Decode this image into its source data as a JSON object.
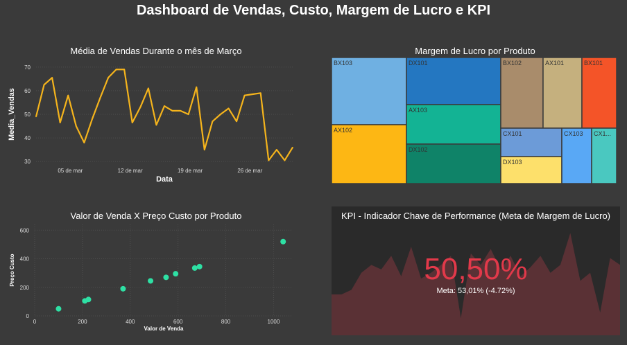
{
  "page": {
    "title": "Dashboard de Vendas, Custo, Margem de Lucro e KPI"
  },
  "line_chart": {
    "title": "Média de Vendas Durante o mês de Março",
    "xlabel": "Data",
    "ylabel": "Media_Vendas",
    "color": "#f5b41c"
  },
  "treemap": {
    "title": "Margem de Lucro por Produto"
  },
  "scatter": {
    "title": "Valor de Venda X Preço Custo por Produto",
    "xlabel": "Valor de Venda",
    "ylabel": "Preço Custo",
    "color": "#2ee0a4"
  },
  "kpi": {
    "title": "KPI - Indicador Chave de Performance (Meta de Margem de Lucro)",
    "value": "50,50%",
    "target": "Meta: 53,01% (-4.72%)",
    "value_color": "#e2394a",
    "area_color": "#5a3135"
  },
  "chart_data": [
    {
      "type": "line",
      "title": "Média de Vendas Durante o mês de Março",
      "xlabel": "Data",
      "ylabel": "Media_Vendas",
      "x_ticks": [
        "05 de mar",
        "12 de mar",
        "19 de mar",
        "26 de mar"
      ],
      "x_tick_days": [
        5,
        12,
        19,
        26
      ],
      "y_ticks": [
        30,
        40,
        50,
        60,
        70
      ],
      "ylim": [
        28,
        72
      ],
      "xlim": [
        1,
        31
      ],
      "x": [
        1,
        2,
        3,
        4,
        5,
        6,
        7,
        8,
        9,
        10,
        11,
        12,
        13,
        14,
        15,
        16,
        17,
        18,
        19,
        20,
        21,
        22,
        23,
        24,
        25,
        26,
        27,
        28,
        29,
        30,
        31
      ],
      "values": [
        49,
        62.5,
        65.5,
        46.5,
        58,
        45,
        38,
        48,
        57,
        65.5,
        69,
        69,
        46.5,
        53,
        61,
        45.5,
        53.5,
        51.5,
        51.5,
        50,
        61.5,
        35,
        47,
        50,
        52.5,
        47,
        58,
        58.5,
        59,
        30.5,
        35,
        30.5,
        36
      ],
      "grid": true
    },
    {
      "type": "treemap",
      "title": "Margem de Lucro por Produto",
      "items": [
        {
          "name": "BX103",
          "color": "#6fb0e2"
        },
        {
          "name": "AX102",
          "color": "#fdb714"
        },
        {
          "name": "DX101",
          "color": "#2477c1"
        },
        {
          "name": "AX103",
          "color": "#13b394"
        },
        {
          "name": "DX102",
          "color": "#0f8368"
        },
        {
          "name": "BX102",
          "color": "#a98c6b"
        },
        {
          "name": "AX101",
          "color": "#c5b07e"
        },
        {
          "name": "BX101",
          "color": "#f45428"
        },
        {
          "name": "CX101",
          "color": "#6c9bd8"
        },
        {
          "name": "DX103",
          "color": "#fde06b"
        },
        {
          "name": "CX103",
          "color": "#59a8f5"
        },
        {
          "name": "CX1...",
          "color": "#4ac8c0"
        }
      ]
    },
    {
      "type": "scatter",
      "title": "Valor de Venda X Preço Custo por Produto",
      "xlabel": "Valor de Venda",
      "ylabel": "Preço Custo",
      "x_ticks": [
        0,
        200,
        400,
        600,
        800,
        1000
      ],
      "y_ticks": [
        0,
        200,
        400,
        600
      ],
      "xlim": [
        0,
        1080
      ],
      "ylim": [
        0,
        640
      ],
      "points": [
        [
          100,
          50
        ],
        [
          210,
          105
        ],
        [
          225,
          115
        ],
        [
          370,
          190
        ],
        [
          485,
          245
        ],
        [
          550,
          270
        ],
        [
          590,
          295
        ],
        [
          670,
          335
        ],
        [
          690,
          345
        ],
        [
          1040,
          520
        ]
      ],
      "grid": true
    },
    {
      "type": "area",
      "title": "KPI - Indicador Chave de Performance (Meta de Margem de Lucro)",
      "values": [
        36,
        36,
        40,
        55,
        62,
        58,
        70,
        52,
        78,
        50,
        55,
        62,
        70,
        15,
        72,
        62,
        76,
        58,
        70,
        52,
        60,
        70,
        55,
        62,
        90,
        48,
        55,
        20,
        68,
        62
      ]
    }
  ]
}
